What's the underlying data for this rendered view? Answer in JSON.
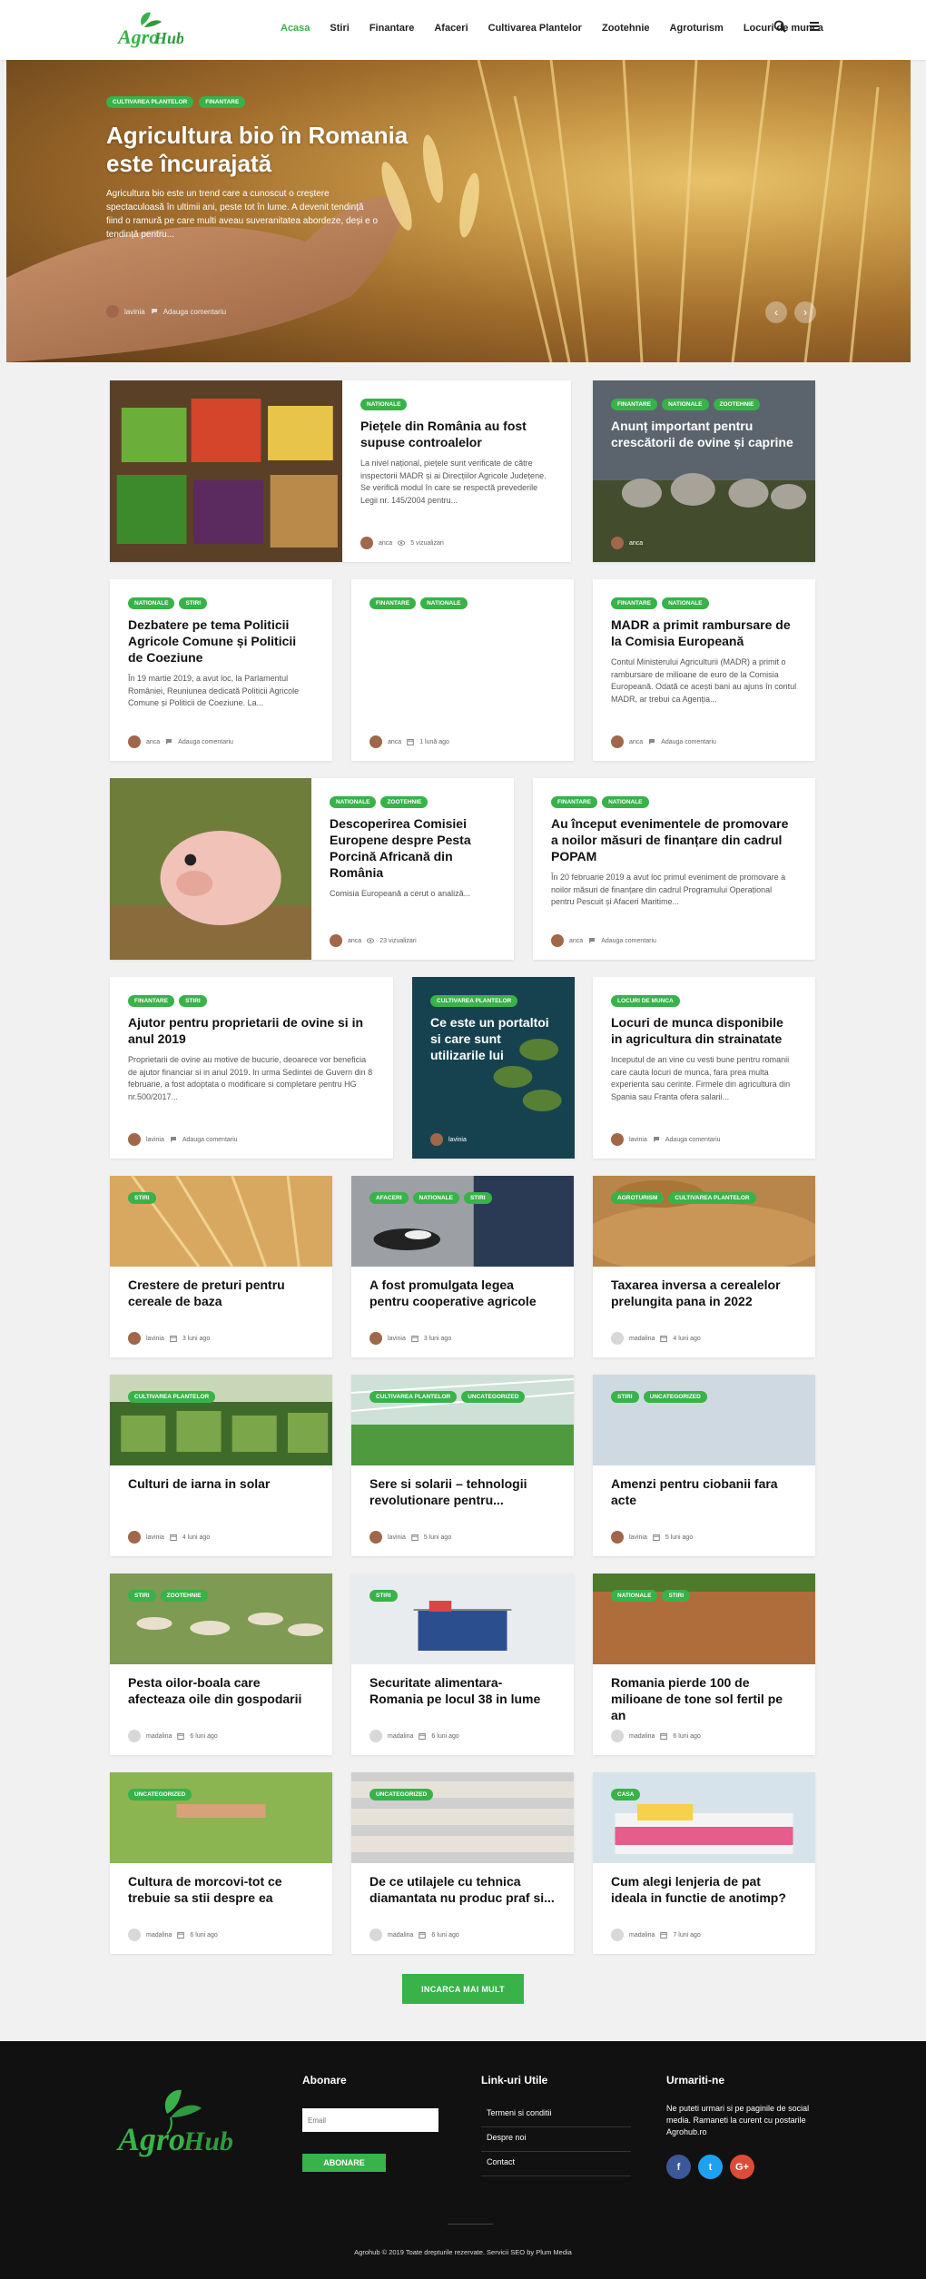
{
  "header": {
    "logo_text": "AgroHub",
    "nav": [
      {
        "label": "Acasa",
        "active": true
      },
      {
        "label": "Stiri",
        "active": false
      },
      {
        "label": "Finantare",
        "active": false
      },
      {
        "label": "Afaceri",
        "active": false
      },
      {
        "label": "Cultivarea Plantelor",
        "active": false
      },
      {
        "label": "Zootehnie",
        "active": false
      },
      {
        "label": "Agroturism",
        "active": false
      },
      {
        "label": "Locuri de munca",
        "active": false
      }
    ],
    "icons": [
      "search-icon",
      "menu-icon"
    ]
  },
  "hero": {
    "tags": [
      "CULTIVAREA PLANTELOR",
      "FINANTARE"
    ],
    "title": "Agricultura bio în Romania este încurajată",
    "excerpt": "Agricultura bio este un trend care a cunoscut o creștere spectaculoasă în ultimii ani, peste tot în lume. A devenit tendință fiind o ramură pe care multi aveau suveranitatea abordeze, deși e o tendință pentru...",
    "author": "lavinia",
    "comments": "Adauga comentariu"
  },
  "cards": [
    {
      "tags": [
        "NATIONALE"
      ],
      "title": "Piețele din România au fost supuse controalelor",
      "excerpt": "La nivel național, piețele sunt verificate de către inspectorii MADR și ai Direcțiilor Agricole Județene. Se verifică modul în care se respectă prevederile Legii nr. 145/2004 pentru...",
      "author": "anca",
      "stat": "5 vizualizari",
      "stat_icon": "eye-icon"
    },
    {
      "tags": [
        "FINANTARE",
        "NATIONALE",
        "ZOOTEHNIE"
      ],
      "title": "Anunț important pentru crescătorii de ovine și caprine",
      "author": "anca"
    },
    {
      "tags": [
        "NATIONALE",
        "STIRI"
      ],
      "title": "Dezbatere pe tema Politicii Agricole Comune și Politicii de Coeziune",
      "excerpt": "În 19 martie 2019, a avut loc, la Parlamentul României, Reuniunea dedicată Politicii Agricole Comune și Politicii de Coeziune. La...",
      "author": "anca",
      "stat": "Adauga comentariu",
      "stat_icon": "comment-icon"
    },
    {
      "tags": [
        "FINANTARE",
        "NATIONALE"
      ],
      "title": "",
      "author": "anca",
      "stat": "1 lună ago",
      "stat_icon": "calendar-icon"
    },
    {
      "tags": [
        "FINANTARE",
        "NATIONALE"
      ],
      "title": "MADR a primit rambursare de la Comisia Europeană",
      "excerpt": "Contul Ministerului Agriculturii (MADR) a primit o rambursare de milioane de euro de la Comisia Europeană. Odată ce acești bani au ajuns în contul MADR, ar trebui ca Agenția...",
      "author": "anca",
      "stat": "Adauga comentariu",
      "stat_icon": "comment-icon"
    },
    {
      "tags": [
        "NATIONALE",
        "ZOOTEHNIE"
      ],
      "title": "Descoperirea Comisiei Europene despre Pesta Porcină Africană din România",
      "excerpt": "Comisia Europeană a cerut o analiză...",
      "author": "anca",
      "stat": "23 vizualizari",
      "stat_icon": "eye-icon"
    },
    {
      "tags": [
        "FINANTARE",
        "NATIONALE"
      ],
      "title": "Au început evenimentele de promovare a noilor măsuri de finanțare din cadrul POPAM",
      "excerpt": "În 20 februarie 2019 a avut loc primul eveniment de promovare a noilor măsuri de finanțare din cadrul Programului Operațional pentru Pescuit și Afaceri Maritime...",
      "author": "anca",
      "stat": "Adauga comentariu",
      "stat_icon": "comment-icon"
    },
    {
      "tags": [
        "FINANTARE",
        "STIRI"
      ],
      "title": "Ajutor pentru proprietarii de ovine si in anul 2019",
      "excerpt": "Proprietarii de ovine au motive de bucurie, deoarece vor beneficia de ajutor financiar si in anul 2019. In urma Sedintei de Guvern din 8 februarie, a fost adoptata o modificare si completare pentru HG nr.500/2017...",
      "author": "lavinia",
      "stat": "Adauga comentariu",
      "stat_icon": "comment-icon"
    },
    {
      "tags": [
        "CULTIVAREA PLANTELOR"
      ],
      "title": "Ce este un portaltoi si care sunt utilizarile lui",
      "author": "lavinia"
    },
    {
      "tags": [
        "LOCURI DE MUNCA"
      ],
      "title": "Locuri de munca disponibile in agricultura din strainatate",
      "excerpt": "Inceputul de an vine cu vesti bune pentru romanii care cauta locuri de munca, fara prea multa experienta sau cerinte. Firmele din agricultura din Spania sau Franta ofera salarii...",
      "author": "lavinia",
      "stat": "Adauga comentariu",
      "stat_icon": "comment-icon"
    },
    {
      "tags": [
        "STIRI"
      ],
      "title": "Crestere de preturi pentru cereale de baza",
      "author": "lavinia",
      "stat": "3 luni ago",
      "stat_icon": "calendar-icon"
    },
    {
      "tags": [
        "AFACERI",
        "NATIONALE",
        "STIRI"
      ],
      "title": "A fost promulgata legea pentru cooperative agricole",
      "author": "lavinia",
      "stat": "3 luni ago",
      "stat_icon": "calendar-icon"
    },
    {
      "tags": [
        "AGROTURISM",
        "CULTIVAREA PLANTELOR"
      ],
      "title": "Taxarea inversa a cerealelor prelungita pana in 2022",
      "author": "madalina",
      "stat": "4 luni ago",
      "stat_icon": "calendar-icon"
    },
    {
      "tags": [
        "CULTIVAREA PLANTELOR"
      ],
      "title": "Culturi de iarna in solar",
      "author": "lavinia",
      "stat": "4 luni ago",
      "stat_icon": "calendar-icon"
    },
    {
      "tags": [
        "CULTIVAREA PLANTELOR",
        "UNCATEGORIZED"
      ],
      "title": "Sere si solarii – tehnologii revolutionare pentru...",
      "author": "lavinia",
      "stat": "5 luni ago",
      "stat_icon": "calendar-icon"
    },
    {
      "tags": [
        "STIRI",
        "UNCATEGORIZED"
      ],
      "title": "Amenzi pentru ciobanii fara acte",
      "author": "lavinia",
      "stat": "5 luni ago",
      "stat_icon": "calendar-icon"
    },
    {
      "tags": [
        "STIRI",
        "ZOOTEHNIE"
      ],
      "title": "Pesta oilor-boala care afecteaza oile din gospodarii",
      "author": "madalina",
      "stat": "6 luni ago",
      "stat_icon": "calendar-icon"
    },
    {
      "tags": [
        "STIRI"
      ],
      "title": "Securitate alimentara-Romania pe locul 38 in lume",
      "author": "madalina",
      "stat": "6 luni ago",
      "stat_icon": "calendar-icon"
    },
    {
      "tags": [
        "NATIONALE",
        "STIRI"
      ],
      "title": "Romania pierde 100 de milioane de tone sol fertil pe an",
      "author": "madalina",
      "stat": "6 luni ago",
      "stat_icon": "calendar-icon"
    },
    {
      "tags": [
        "UNCATEGORIZED"
      ],
      "title": "Cultura de morcovi-tot ce trebuie sa stii despre ea",
      "author": "madalina",
      "stat": "6 luni ago",
      "stat_icon": "calendar-icon"
    },
    {
      "tags": [
        "UNCATEGORIZED"
      ],
      "title": "De ce utilajele cu tehnica diamantata nu produc praf si...",
      "author": "madalina",
      "stat": "6 luni ago",
      "stat_icon": "calendar-icon"
    },
    {
      "tags": [
        "CASA"
      ],
      "title": "Cum alegi lenjeria de pat ideala in functie de anotimp?",
      "author": "madalina",
      "stat": "7 luni ago",
      "stat_icon": "calendar-icon"
    }
  ],
  "load_more": "INCARCA MAI MULT",
  "footer": {
    "logo_text": "AgroHub",
    "subscribe_title": "Abonare",
    "email_placeholder": "Email",
    "subscribe_button": "ABONARE",
    "links_title": "Link-uri Utile",
    "links": [
      "Termeni si conditii",
      "Despre noi",
      "Contact"
    ],
    "follow_title": "Urmariti-ne",
    "follow_text": "Ne puteti urmari si pe paginile de social media. Ramaneti la curent cu postarile Agrohub.ro",
    "socials": [
      {
        "name": "facebook",
        "glyph": "f",
        "color": "#3b5998"
      },
      {
        "name": "twitter",
        "glyph": "t",
        "color": "#1da1f2"
      },
      {
        "name": "google-plus",
        "glyph": "G+",
        "color": "#dd4b39"
      }
    ],
    "copyright": "Agrohub © 2019 Toate drepturile rezervate. Servicii SEO by Plum Media"
  },
  "colors": {
    "accent": "#38b249",
    "footer_bg": "#111111"
  }
}
